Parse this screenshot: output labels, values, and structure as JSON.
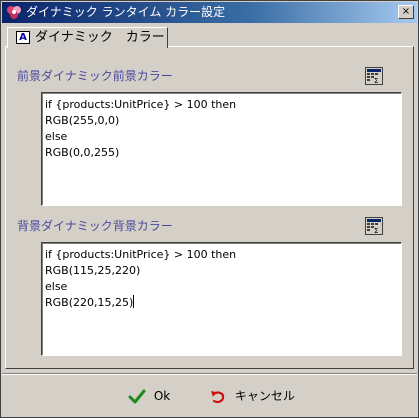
{
  "window": {
    "title": "ダイナミック ランタイム カラー設定",
    "close_glyph": "×"
  },
  "tab": {
    "icon_letter": "A",
    "label": "ダイナミック　カラー"
  },
  "foreground": {
    "label": "前景ダイナミック前景カラー",
    "lines": [
      "if {products:UnitPrice} > 100 then",
      "RGB(255,0,0)",
      "else",
      "RGB(0,0,255)"
    ]
  },
  "background": {
    "label": "背景ダイナミック背景カラー",
    "lines": [
      "if {products:UnitPrice} > 100 then",
      "RGB(115,25,220)",
      "else",
      "RGB(220,15,25)"
    ]
  },
  "buttons": {
    "ok_label": "Ok",
    "cancel_label": "キャンセル"
  },
  "icons": {
    "window": "app-icon",
    "formula": "formula-editor-icon",
    "ok": "checkmark-icon",
    "cancel": "undo-arrow-icon"
  },
  "colors": {
    "title_gradient_start": "#0a246a",
    "title_gradient_end": "#a6caf0",
    "section_label": "#4a4a9c",
    "ok_check": "#1a8a1a",
    "cancel_arrow": "#d01010"
  }
}
